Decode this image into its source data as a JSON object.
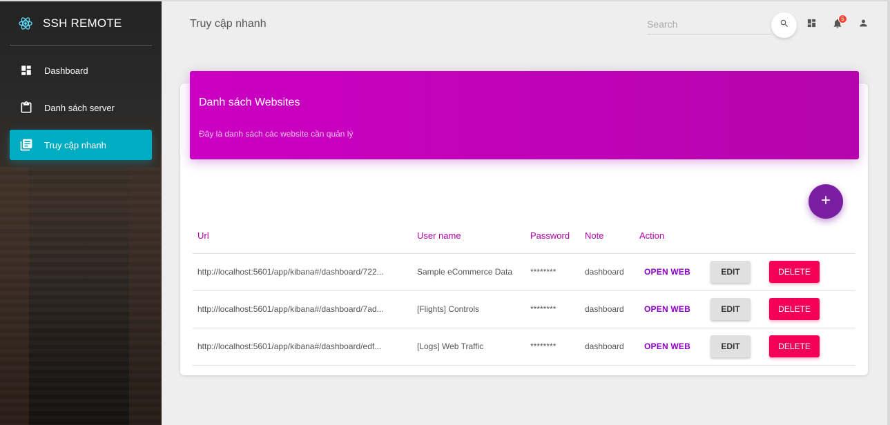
{
  "brand": {
    "title": "SSH REMOTE",
    "logo_icon": "react-atom-icon"
  },
  "sidebar": {
    "items": [
      {
        "label": "Dashboard",
        "icon": "dashboard-icon",
        "active": false
      },
      {
        "label": "Danh sách server",
        "icon": "clipboard-icon",
        "active": false
      },
      {
        "label": "Truy cập nhanh",
        "icon": "library-books-icon",
        "active": true
      }
    ],
    "active_color": "#00acc1"
  },
  "header": {
    "title": "Truy cập nhanh",
    "search_placeholder": "Search",
    "notification_count": "5"
  },
  "card": {
    "title": "Danh sách Websites",
    "subtitle": "Đây là danh sách các website cần quản lý",
    "header_color": "#cc00c2"
  },
  "table": {
    "columns": [
      "Url",
      "User name",
      "Password",
      "Note",
      "Action"
    ],
    "rows": [
      {
        "url": "http://localhost:5601/app/kibana#/dashboard/722...",
        "user": "Sample eCommerce Data",
        "password": "********",
        "note": "dashboard"
      },
      {
        "url": "http://localhost:5601/app/kibana#/dashboard/7ad...",
        "user": "[Flights] Controls",
        "password": "********",
        "note": "dashboard"
      },
      {
        "url": "http://localhost:5601/app/kibana#/dashboard/edf...",
        "user": "[Logs] Web Traffic",
        "password": "********",
        "note": "dashboard"
      }
    ],
    "actions": {
      "open": "OPEN WEB",
      "edit": "EDIT",
      "delete": "DELETE"
    }
  }
}
